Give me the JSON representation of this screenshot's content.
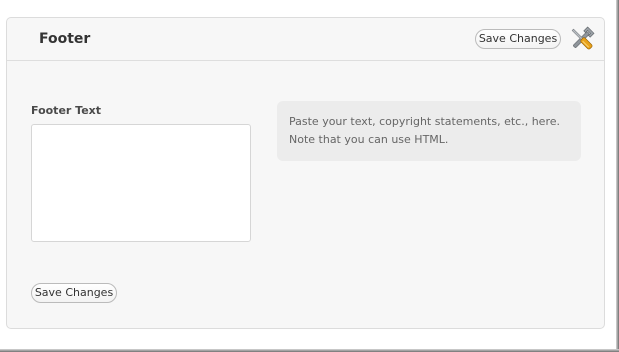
{
  "panel": {
    "title": "Footer",
    "save_label_top": "Save Changes",
    "tools_icon": "screwdriver-wrench-icon"
  },
  "field": {
    "label": "Footer Text",
    "value": ""
  },
  "help": {
    "line1": "Paste your text, copyright statements, etc., here.",
    "line2": "Note that you can use HTML."
  },
  "actions": {
    "save_label_bottom": "Save Changes"
  },
  "colors": {
    "panel_bg": "#f7f7f7",
    "help_bg": "#ececec",
    "icon_orange": "#e8a21a",
    "icon_steel": "#9aa0a6"
  }
}
